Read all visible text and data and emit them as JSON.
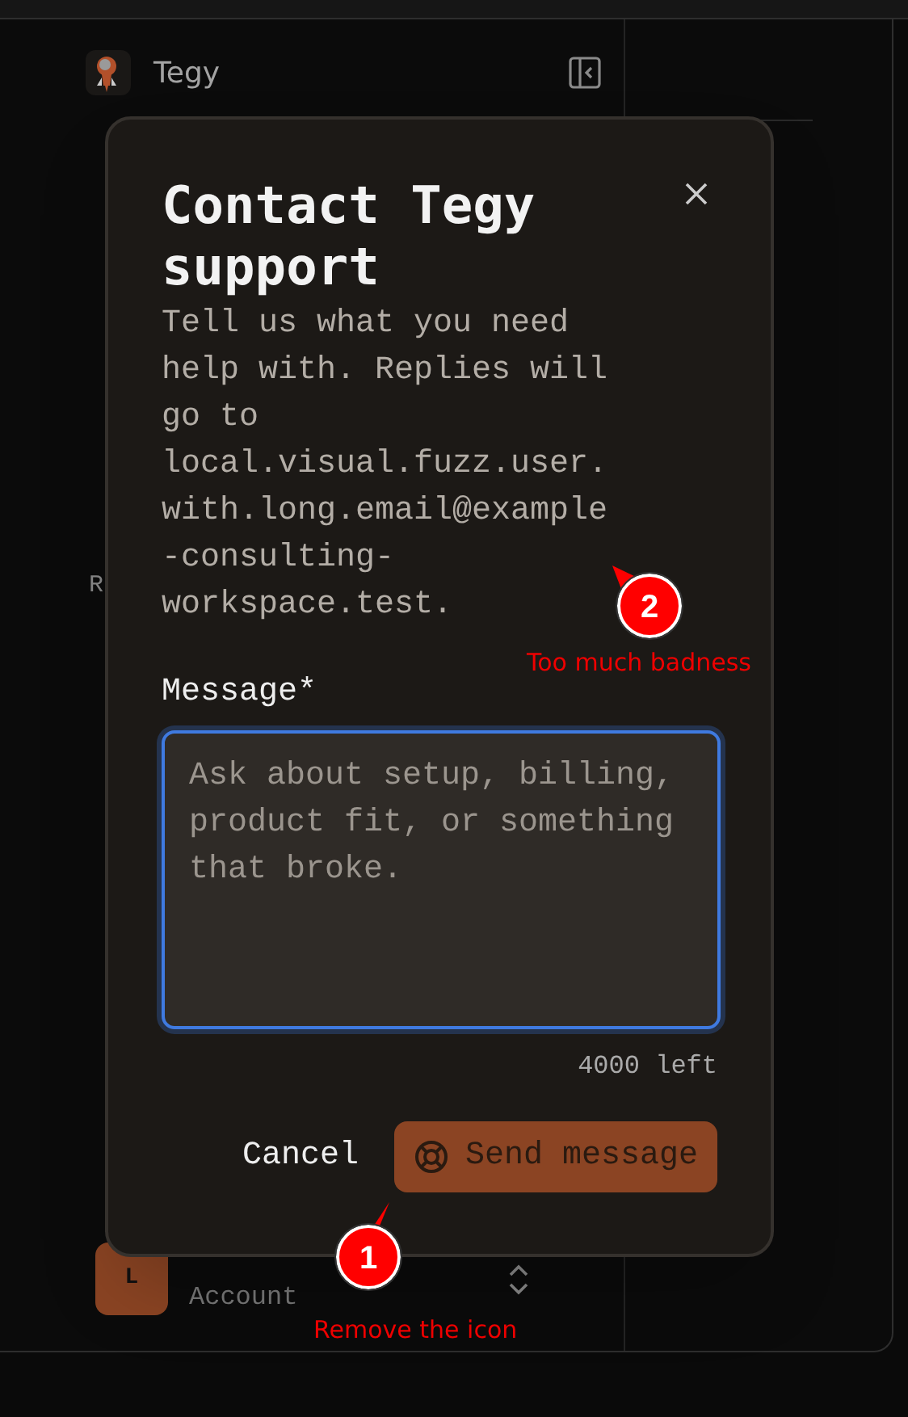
{
  "app": {
    "brand": "Tegy",
    "side_text": "R",
    "account": {
      "initial": "L",
      "role": "Account"
    }
  },
  "dialog": {
    "title": "Contact Tegy support",
    "description": "Tell us what you need help with. Replies will go to local.visual.fuzz.user.with.long.email@example-consulting-workspace.test.",
    "field": {
      "label": "Message*",
      "placeholder": "Ask about setup, billing, product fit, or something that broke.",
      "counter": "4000 left"
    },
    "buttons": [
      {
        "kind": "secondary",
        "label": "Cancel"
      },
      {
        "kind": "primary",
        "label": "Send message"
      }
    ]
  },
  "annotations": [
    {
      "number": "1",
      "note": "Remove the icon"
    },
    {
      "number": "2",
      "note": "Too much badness"
    }
  ]
}
